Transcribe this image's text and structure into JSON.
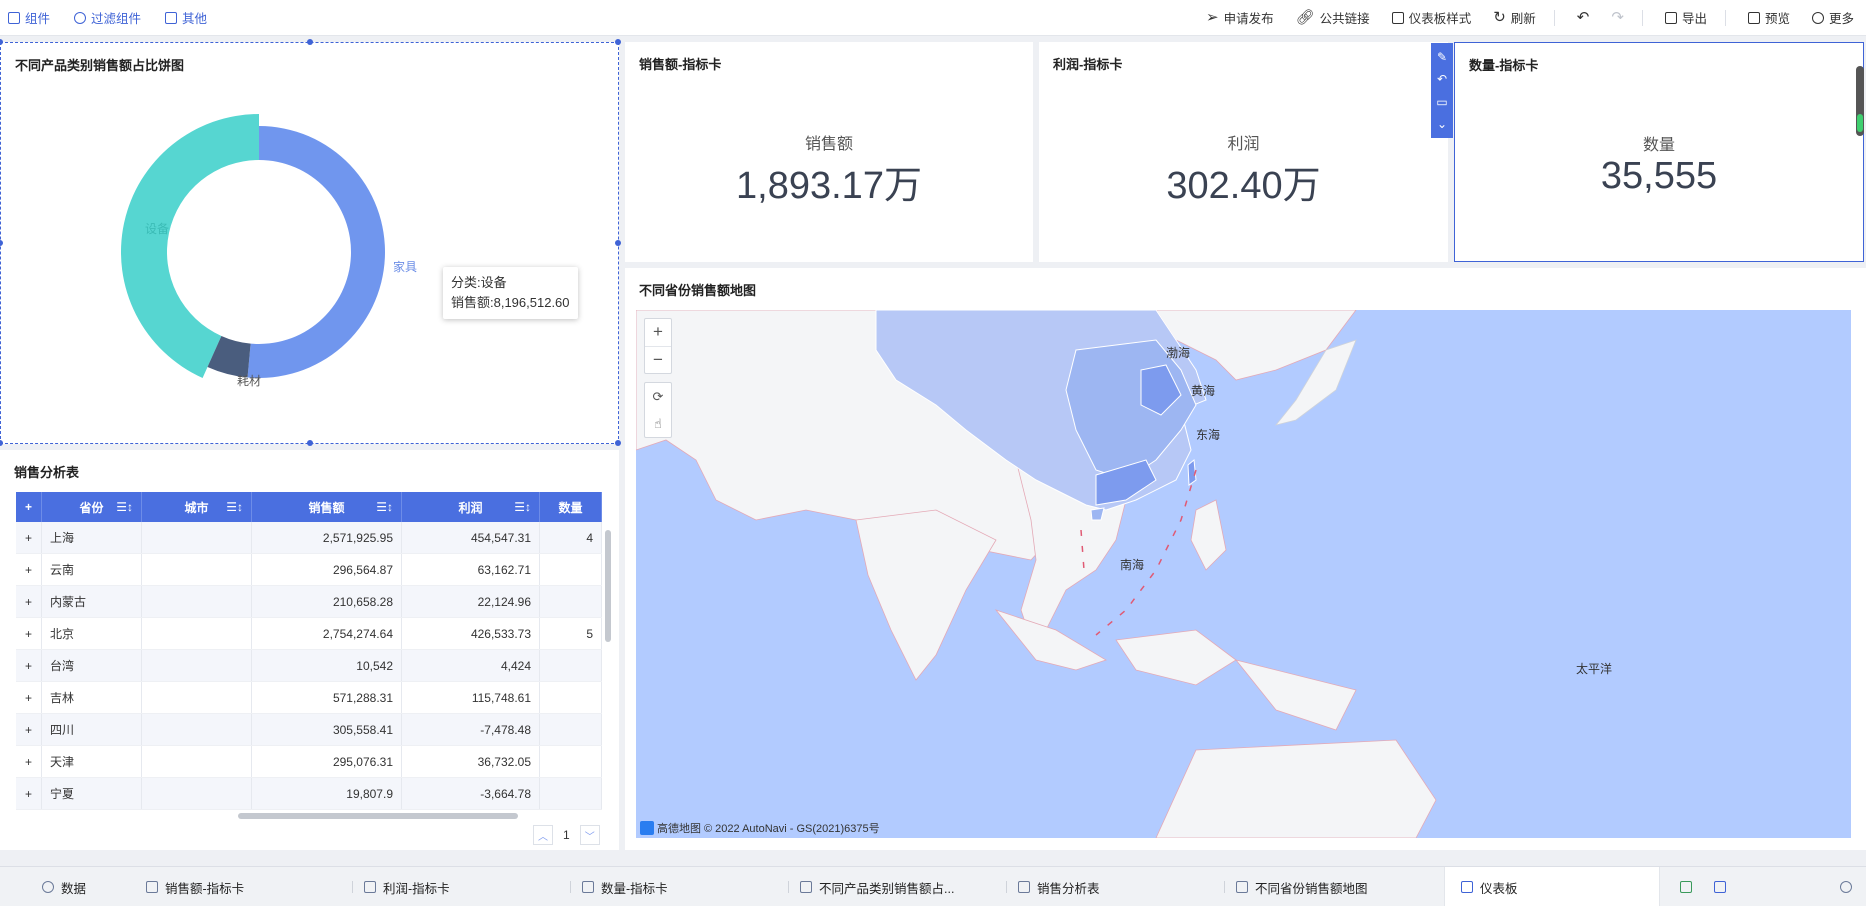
{
  "toolbar": {
    "left": [
      {
        "label": "组件",
        "icon": "component-icon"
      },
      {
        "label": "过滤组件",
        "icon": "filter-component-icon"
      },
      {
        "label": "其他",
        "icon": "other-icon"
      }
    ],
    "right": {
      "publish": "申请发布",
      "public_link": "公共链接",
      "dashboard_style": "仪表板样式",
      "refresh": "刷新",
      "export": "导出",
      "preview": "预览",
      "more": "更多"
    }
  },
  "pie_panel": {
    "title": "不同产品类别销售额占比饼图",
    "tooltip_category": "分类:设备",
    "tooltip_value": "销售额:8,196,512.60",
    "label_device": "设备",
    "label_furniture": "家具",
    "label_consumables": "耗材"
  },
  "chart_data": {
    "type": "pie",
    "categories": [
      "设备",
      "家具",
      "耗材"
    ],
    "values": [
      8196512.6,
      9740000,
      994000
    ],
    "colors": [
      "#56d6d1",
      "#7096ee",
      "#4a5d7e"
    ],
    "title": "不同产品类别销售额占比饼图"
  },
  "kpis": [
    {
      "title": "销售额-指标卡",
      "label": "销售额",
      "value": "1,893.17万"
    },
    {
      "title": "利润-指标卡",
      "label": "利润",
      "value": "302.40万"
    },
    {
      "title": "数量-指标卡",
      "label": "数量",
      "value": "35,555"
    }
  ],
  "table_panel": {
    "title": "销售分析表",
    "headers": {
      "plus": "+",
      "province": "省份",
      "city": "城市",
      "sales": "销售额",
      "profit": "利润",
      "qty": "数量"
    },
    "rows": [
      {
        "province": "上海",
        "sales": "2,571,925.95",
        "profit": "454,547.31",
        "qty": "4"
      },
      {
        "province": "云南",
        "sales": "296,564.87",
        "profit": "63,162.71",
        "qty": ""
      },
      {
        "province": "内蒙古",
        "sales": "210,658.28",
        "profit": "22,124.96",
        "qty": ""
      },
      {
        "province": "北京",
        "sales": "2,754,274.64",
        "profit": "426,533.73",
        "qty": "5"
      },
      {
        "province": "台湾",
        "sales": "10,542",
        "profit": "4,424",
        "qty": ""
      },
      {
        "province": "吉林",
        "sales": "571,288.31",
        "profit": "115,748.61",
        "qty": ""
      },
      {
        "province": "四川",
        "sales": "305,558.41",
        "profit": "-7,478.48",
        "qty": ""
      },
      {
        "province": "天津",
        "sales": "295,076.31",
        "profit": "36,732.05",
        "qty": ""
      },
      {
        "province": "宁夏",
        "sales": "19,807.9",
        "profit": "-3,664.78",
        "qty": ""
      }
    ],
    "page": "1"
  },
  "map_panel": {
    "title": "不同省份销售额地图",
    "labels": {
      "bohai": "渤海",
      "huanghai": "黄海",
      "donghai": "东海",
      "nanhai": "南海",
      "pacific": "太平洋"
    },
    "zoom_in": "+",
    "zoom_out": "−",
    "attribution_brand": "高德地图",
    "attribution_text": "© 2022 AutoNavi - GS(2021)6375号"
  },
  "bottom_tabs": [
    {
      "label": "数据"
    },
    {
      "label": "销售额-指标卡"
    },
    {
      "label": "利润-指标卡"
    },
    {
      "label": "数量-指标卡"
    },
    {
      "label": "不同产品类别销售额占..."
    },
    {
      "label": "销售分析表"
    },
    {
      "label": "不同省份销售额地图"
    },
    {
      "label": "仪表板"
    }
  ],
  "colors": {
    "accent": "#3f63d6",
    "header": "#4a6fe0",
    "map_sea": "#b2cbff"
  }
}
